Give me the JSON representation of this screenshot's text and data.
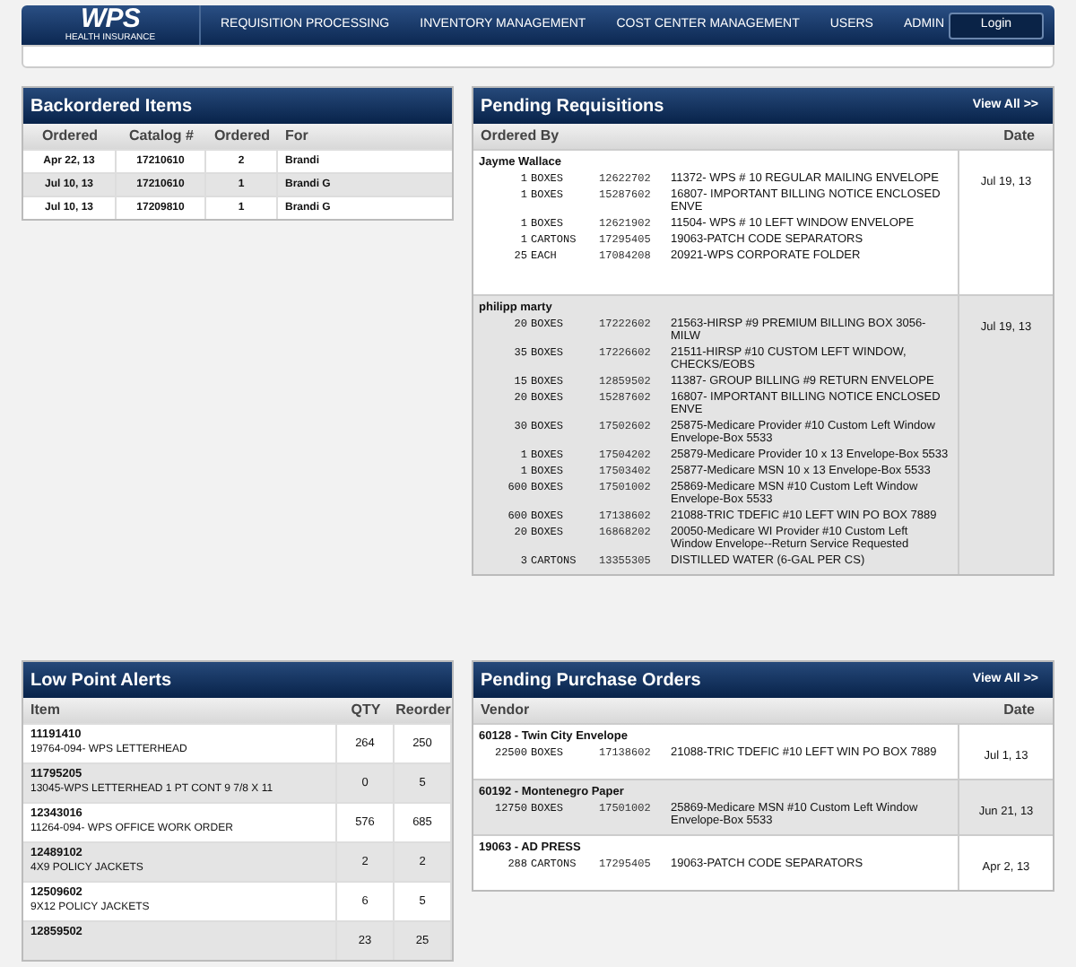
{
  "header": {
    "logo": "WPS",
    "logo_tagline": "HEALTH INSURANCE",
    "nav": [
      "REQUISITION PROCESSING",
      "INVENTORY MANAGEMENT",
      "COST CENTER MANAGEMENT",
      "USERS",
      "ADMIN"
    ],
    "login": "Login"
  },
  "backordered": {
    "title": "Backordered Items",
    "columns": [
      "Ordered",
      "Catalog #",
      "Ordered",
      "For"
    ],
    "rows": [
      [
        "Apr 22, 13",
        "17210610",
        "2",
        "Brandi"
      ],
      [
        "Jul 10, 13",
        "17210610",
        "1",
        "Brandi G"
      ],
      [
        "Jul 10, 13",
        "17209810",
        "1",
        "Brandi G"
      ]
    ]
  },
  "pending_requisitions": {
    "title": "Pending Requisitions",
    "view_all": "View All >>",
    "columns": [
      "Ordered By",
      "Date"
    ],
    "groups": [
      {
        "name": "Jayme Wallace",
        "date": "Jul 19, 13",
        "items": [
          {
            "qty": "1",
            "unit": "BOXES",
            "catalog": "12622702",
            "description": "11372- WPS # 10 REGULAR MAILING ENVELOPE"
          },
          {
            "qty": "1",
            "unit": "BOXES",
            "catalog": "15287602",
            "description": "16807- IMPORTANT BILLING NOTICE ENCLOSED ENVE"
          },
          {
            "qty": "1",
            "unit": "BOXES",
            "catalog": "12621902",
            "description": "11504- WPS # 10 LEFT WINDOW ENVELOPE"
          },
          {
            "qty": "1",
            "unit": "CARTONS",
            "catalog": "17295405",
            "description": "19063-PATCH CODE SEPARATORS"
          },
          {
            "qty": "25",
            "unit": "EACH",
            "catalog": "17084208",
            "description": "20921-WPS CORPORATE FOLDER"
          }
        ]
      },
      {
        "name": "philipp marty",
        "date": "Jul 19, 13",
        "items": [
          {
            "qty": "20",
            "unit": "BOXES",
            "catalog": "17222602",
            "description": "21563-HIRSP #9 PREMIUM BILLING BOX 3056-MILW"
          },
          {
            "qty": "35",
            "unit": "BOXES",
            "catalog": "17226602",
            "description": "21511-HIRSP #10 CUSTOM LEFT WINDOW, CHECKS/EOBS"
          },
          {
            "qty": "15",
            "unit": "BOXES",
            "catalog": "12859502",
            "description": "11387- GROUP BILLING #9 RETURN ENVELOPE"
          },
          {
            "qty": "20",
            "unit": "BOXES",
            "catalog": "15287602",
            "description": "16807- IMPORTANT BILLING NOTICE ENCLOSED ENVE"
          },
          {
            "qty": "30",
            "unit": "BOXES",
            "catalog": "17502602",
            "description": "25875-Medicare Provider #10 Custom Left Window Envelope-Box 5533"
          },
          {
            "qty": "1",
            "unit": "BOXES",
            "catalog": "17504202",
            "description": "25879-Medicare Provider 10 x 13 Envelope-Box 5533"
          },
          {
            "qty": "1",
            "unit": "BOXES",
            "catalog": "17503402",
            "description": "25877-Medicare MSN 10 x 13 Envelope-Box 5533"
          },
          {
            "qty": "600",
            "unit": "BOXES",
            "catalog": "17501002",
            "description": "25869-Medicare MSN #10 Custom Left Window Envelope-Box 5533"
          },
          {
            "qty": "600",
            "unit": "BOXES",
            "catalog": "17138602",
            "description": "21088-TRIC TDEFIC #10 LEFT WIN PO BOX 7889"
          },
          {
            "qty": "20",
            "unit": "BOXES",
            "catalog": "16868202",
            "description": "20050-Medicare WI Provider #10 Custom Left Window Envelope--Return Service Requested"
          },
          {
            "qty": "3",
            "unit": "CARTONS",
            "catalog": "13355305",
            "description": "DISTILLED WATER (6-GAL PER CS)"
          }
        ]
      }
    ]
  },
  "low_point_alerts": {
    "title": "Low Point Alerts",
    "columns": [
      "Item",
      "QTY",
      "Reorder"
    ],
    "rows": [
      {
        "item": "11191410",
        "description": "19764-094- WPS LETTERHEAD",
        "qty": "264",
        "reorder": "250"
      },
      {
        "item": "11795205",
        "description": "13045-WPS LETTERHEAD 1 PT CONT 9 7/8 X 11",
        "qty": "0",
        "reorder": "5"
      },
      {
        "item": "12343016",
        "description": "11264-094- WPS OFFICE WORK ORDER",
        "qty": "576",
        "reorder": "685"
      },
      {
        "item": "12489102",
        "description": "4X9 POLICY JACKETS",
        "qty": "2",
        "reorder": "2"
      },
      {
        "item": "12509602",
        "description": "9X12 POLICY JACKETS",
        "qty": "6",
        "reorder": "5"
      },
      {
        "item": "12859502",
        "qty": "23",
        "reorder": "25"
      }
    ]
  },
  "pending_purchase_orders": {
    "title": "Pending Purchase Orders",
    "view_all": "View All >>",
    "columns": [
      "Vendor",
      "Date"
    ],
    "groups": [
      {
        "name": "60128 - Twin City Envelope",
        "date": "Jul 1, 13",
        "items": [
          {
            "qty": "22500",
            "unit": "BOXES",
            "catalog": "17138602",
            "description": "21088-TRIC TDEFIC #10 LEFT WIN PO BOX 7889"
          }
        ]
      },
      {
        "name": "60192 - Montenegro Paper",
        "date": "Jun 21, 13",
        "items": [
          {
            "qty": "12750",
            "unit": "BOXES",
            "catalog": "17501002",
            "description": "25869-Medicare MSN #10 Custom Left Window Envelope-Box 5533"
          }
        ]
      },
      {
        "name": "19063 - AD PRESS",
        "date": "Apr 2, 13",
        "items": [
          {
            "qty": "288",
            "unit": "CARTONS",
            "catalog": "17295405",
            "description": "19063-PATCH CODE SEPARATORS"
          }
        ]
      }
    ]
  }
}
